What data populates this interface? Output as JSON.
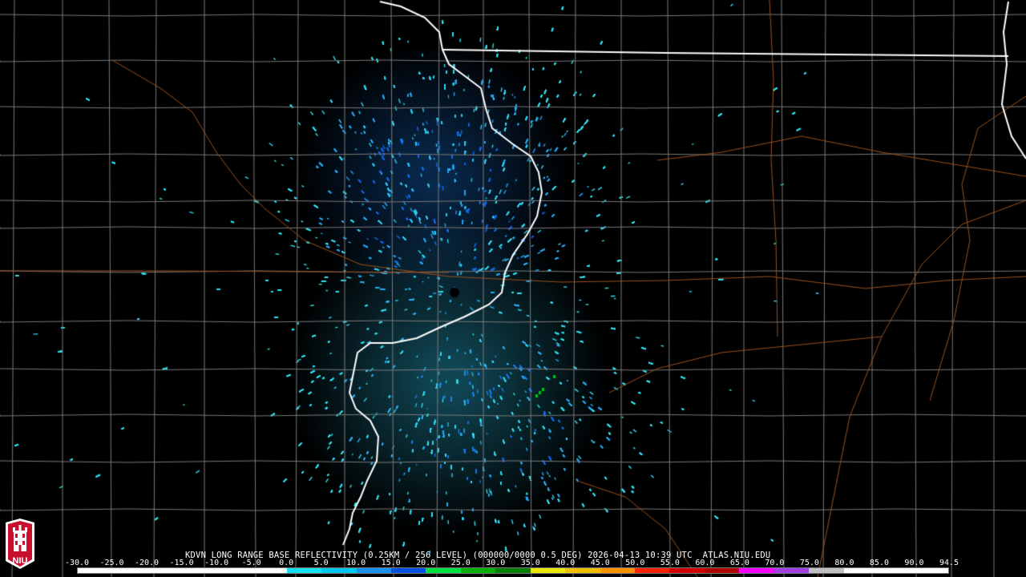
{
  "product_title": "KDVN LONG RANGE BASE REFLECTIVITY (0.25KM / 256 LEVEL) (000000/0000 0.5 DEG) 2026-04-13 10:39 UTC  ATLAS.NIU.EDU",
  "logo": {
    "text": "NIU",
    "icon": "niu-tower-logo-icon",
    "color": "#c8102e"
  },
  "colorbar": {
    "tick_labels": [
      "-30.0",
      "-25.0",
      "-20.0",
      "-15.0",
      "-10.0",
      "-5.0",
      "0.0",
      "5.0",
      "10.0",
      "15.0",
      "20.0",
      "25.0",
      "30.0",
      "35.0",
      "40.0",
      "45.0",
      "50.0",
      "55.0",
      "60.0",
      "65.0",
      "70.0",
      "75.0",
      "80.0",
      "85.0",
      "90.0",
      "94.5"
    ],
    "colors": [
      "#ffffff",
      "#ffffff",
      "#ffffff",
      "#ffffff",
      "#ffffff",
      "#ffffff",
      "#10e0f0",
      "#00c8f0",
      "#1890f0",
      "#0050e0",
      "#00e040",
      "#00b000",
      "#008000",
      "#e8e800",
      "#f0c000",
      "#ff9000",
      "#ff2000",
      "#d00000",
      "#b00000",
      "#ff00ff",
      "#a040e0",
      "#c0c0c0",
      "#ffffff",
      "#ffffff",
      "#ffffff"
    ]
  },
  "map_colors": {
    "background": "#000000",
    "county_lines": "#7a7a7a",
    "state_lines": "#ffffff",
    "highways": "#9a5020",
    "echo_light": "#30e0f0",
    "echo_mid": "#28a8f0",
    "echo_deep": "#1060e8",
    "echo_green": "#00c020"
  }
}
